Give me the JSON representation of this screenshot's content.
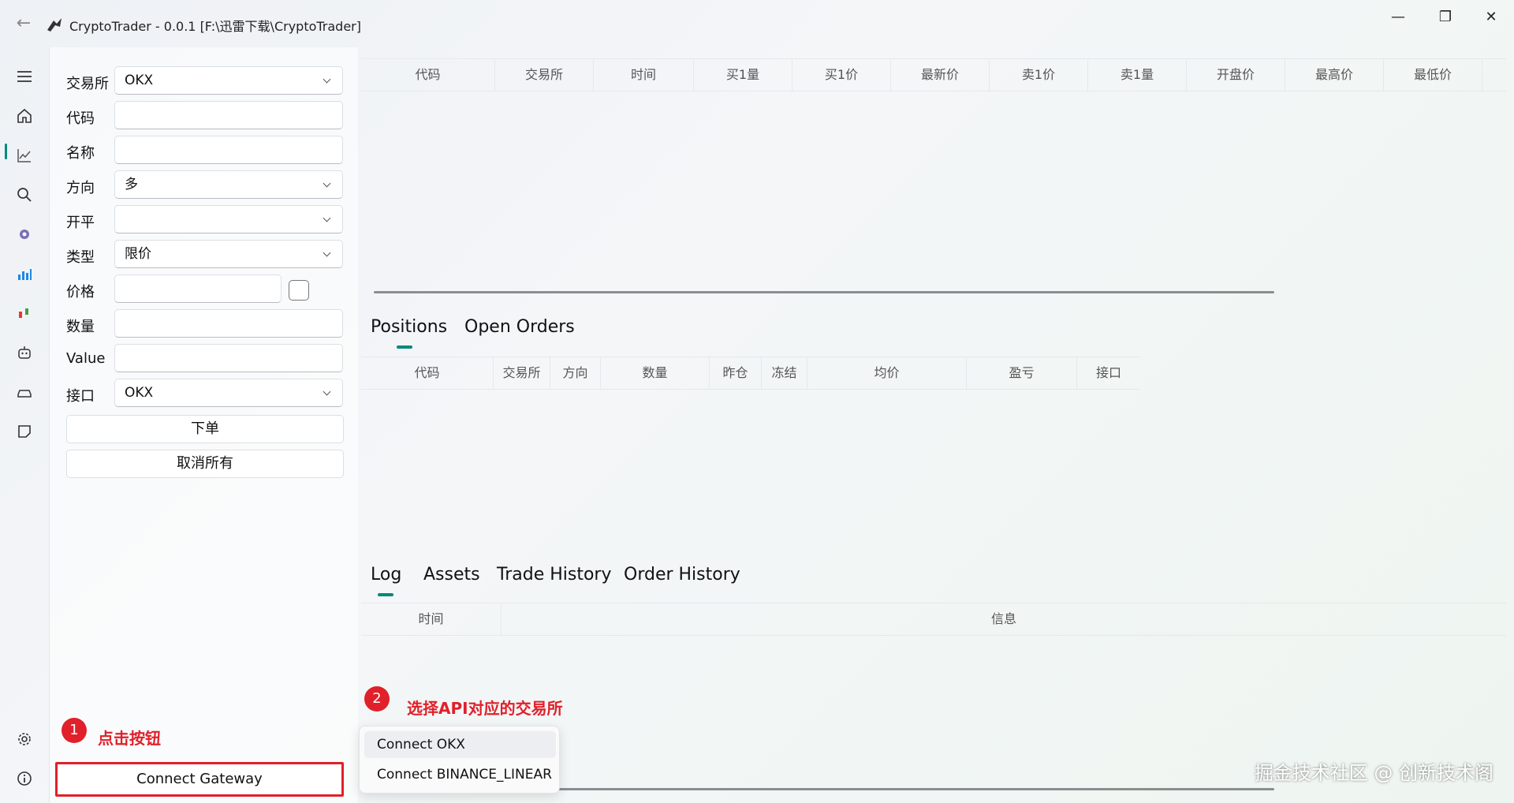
{
  "window": {
    "title": "CryptoTrader - 0.0.1  [F:\\迅雷下载\\CryptoTrader]",
    "minimize": "—",
    "maximize": "❐",
    "close": "✕"
  },
  "form": {
    "exchange_label": "交易所",
    "exchange_value": "OKX",
    "code_label": "代码",
    "code_value": "",
    "name_label": "名称",
    "name_value": "",
    "direction_label": "方向",
    "direction_value": "多",
    "offset_label": "开平",
    "offset_value": "",
    "type_label": "类型",
    "type_value": "限价",
    "price_label": "价格",
    "price_value": "",
    "volume_label": "数量",
    "volume_value": "",
    "value_label": "Value",
    "value_value": "",
    "gateway_label": "接口",
    "gateway_value": "OKX",
    "send_order": "下单",
    "cancel_all": "取消所有"
  },
  "market_table": {
    "headers": [
      "代码",
      "交易所",
      "时间",
      "买1量",
      "买1价",
      "最新价",
      "卖1价",
      "卖1量",
      "开盘价",
      "最高价",
      "最低价"
    ]
  },
  "positions": {
    "tabs": [
      "Positions",
      "Open Orders"
    ],
    "headers": [
      "代码",
      "交易所",
      "方向",
      "数量",
      "昨仓",
      "冻结",
      "均价",
      "盈亏",
      "接口"
    ]
  },
  "logs": {
    "tabs": [
      "Log",
      "Assets",
      "Trade History",
      "Order History"
    ],
    "headers": [
      "时间",
      "信息"
    ]
  },
  "connect_button": "Connect Gateway",
  "connect_menu": [
    "Connect OKX",
    "Connect BINANCE_LINEAR"
  ],
  "annotations": {
    "step1_num": "1",
    "step1_text": "点击按钮",
    "step2_num": "2",
    "step2_text": "选择API对应的交易所"
  },
  "watermark": "掘金技术社区 @ 创新技术阁",
  "colors": {
    "accent": "#00897b",
    "annotation": "#e0202a"
  }
}
